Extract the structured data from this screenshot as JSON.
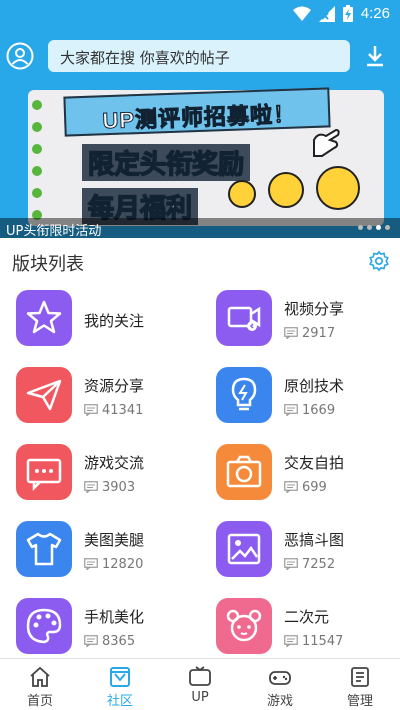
{
  "status": {
    "time": "4:26"
  },
  "header": {
    "search_placeholder": "大家都在搜  你喜欢的帖子"
  },
  "banner": {
    "title": "UP测评师招募啦！",
    "line2": "限定头衔奖励",
    "line3": "每月福利",
    "caption": "UP头衔限时活动",
    "page_count": 4,
    "active_page": 3
  },
  "section": {
    "title": "版块列表"
  },
  "boards": [
    {
      "name": "我的关注",
      "count": "",
      "icon": "star-icon",
      "color": "#8c5cf0"
    },
    {
      "name": "视频分享",
      "count": "2917",
      "icon": "video-icon",
      "color": "#8c5cf0"
    },
    {
      "name": "资源分享",
      "count": "41341",
      "icon": "send-icon",
      "color": "#f0575e"
    },
    {
      "name": "原创技术",
      "count": "1669",
      "icon": "bulb-icon",
      "color": "#3a86ee"
    },
    {
      "name": "游戏交流",
      "count": "3903",
      "icon": "chat-icon",
      "color": "#f0575e"
    },
    {
      "name": "交友自拍",
      "count": "699",
      "icon": "camera-icon",
      "color": "#f58a3a"
    },
    {
      "name": "美图美腿",
      "count": "12820",
      "icon": "shirt-icon",
      "color": "#3a86ee"
    },
    {
      "name": "恶搞斗图",
      "count": "7252",
      "icon": "image-icon",
      "color": "#8c5cf0"
    },
    {
      "name": "手机美化",
      "count": "8365",
      "icon": "palette-icon",
      "color": "#8c5cf0"
    },
    {
      "name": "二次元",
      "count": "11547",
      "icon": "bear-icon",
      "color": "#f06a90"
    }
  ],
  "nav": [
    {
      "label": "首页",
      "icon": "home-icon",
      "active": false
    },
    {
      "label": "社区",
      "icon": "community-icon",
      "active": true
    },
    {
      "label": "UP",
      "icon": "up-icon",
      "active": false
    },
    {
      "label": "游戏",
      "icon": "game-icon",
      "active": false
    },
    {
      "label": "管理",
      "icon": "manage-icon",
      "active": false
    }
  ],
  "colors": {
    "primary": "#29a8e9"
  }
}
